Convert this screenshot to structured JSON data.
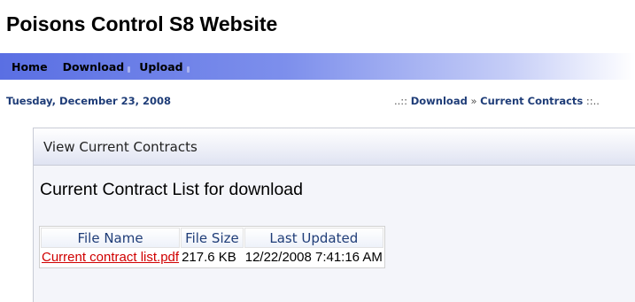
{
  "site": {
    "title": "Poisons Control S8 Website"
  },
  "nav": {
    "items": [
      {
        "label": "Home",
        "has_dropdown": false
      },
      {
        "label": "Download",
        "has_dropdown": true
      },
      {
        "label": "Upload",
        "has_dropdown": true
      }
    ]
  },
  "date": "Tuesday, December 23, 2008",
  "breadcrumb": {
    "prefix": "..::",
    "items": [
      "Download",
      "Current Contracts"
    ],
    "separator": "»",
    "suffix": "::.."
  },
  "panel": {
    "title": "View Current Contracts",
    "heading": "Current Contract List for download"
  },
  "files_table": {
    "columns": [
      "File Name",
      "File Size",
      "Last Updated"
    ],
    "rows": [
      {
        "name": "Current contract list.pdf",
        "size": "217.6 KB",
        "updated": "12/22/2008 7:41:16 AM"
      }
    ]
  },
  "colors": {
    "nav_gradient_start": "#5a6fe3",
    "text_dark_blue": "#1f3d78",
    "link_red": "#d00000"
  }
}
